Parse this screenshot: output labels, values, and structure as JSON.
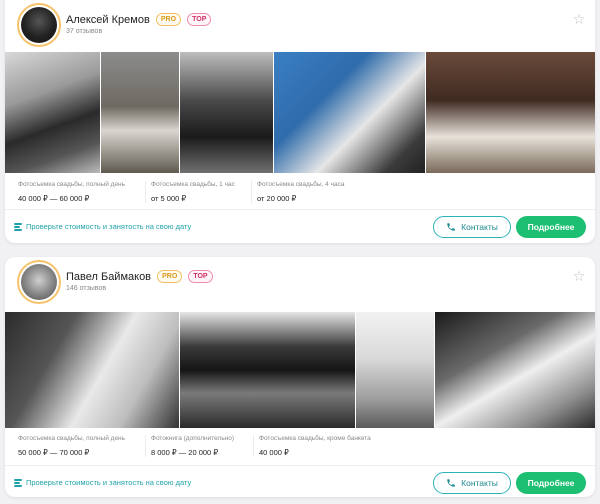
{
  "cards": [
    {
      "name": "Алексей Кремов",
      "badges": {
        "pro": "PRO",
        "top": "TOP"
      },
      "reviews": "37 отзывов",
      "prices": [
        {
          "label": "Фотосъемка свадьбы, полный день",
          "value": "40 000 ₽ — 60 000 ₽"
        },
        {
          "label": "Фотосъемка свадьбы, 1 час",
          "value": "от 5 000 ₽"
        },
        {
          "label": "Фотосъемка свадьбы, 4 часа",
          "value": "от 20 000 ₽"
        }
      ],
      "check_link": "Проверьте стоимость и занятость на свою дату",
      "contacts_label": "Контакты",
      "more_label": "Подробнее"
    },
    {
      "name": "Павел Баймаков",
      "badges": {
        "pro": "PRO",
        "top": "TOP"
      },
      "reviews": "146 отзывов",
      "prices": [
        {
          "label": "Фотосъемка свадьбы, полный день",
          "value": "50 000 ₽ — 70 000 ₽"
        },
        {
          "label": "Фотокнига (дополнительно)",
          "value": "8 000 ₽ — 20 000 ₽"
        },
        {
          "label": "Фотосъемка свадьбы, кроме банкета",
          "value": "40 000 ₽"
        }
      ],
      "check_link": "Проверьте стоимость и занятость на свою дату",
      "contacts_label": "Контакты",
      "more_label": "Подробнее"
    }
  ],
  "colors": {
    "accent_green": "#1dbf73",
    "accent_teal": "#1fa3a8",
    "pro": "#d99a1d",
    "top": "#d0306a"
  }
}
